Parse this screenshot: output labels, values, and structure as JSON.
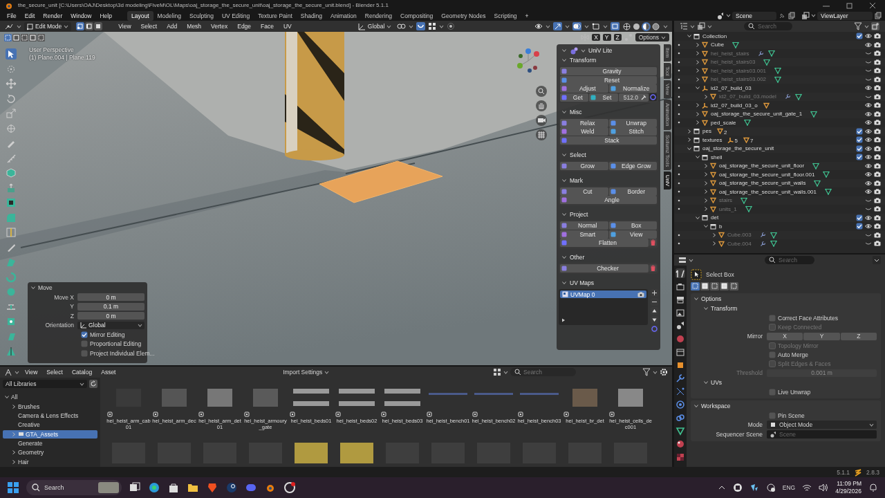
{
  "window": {
    "title": "the_secure_unit [C:\\Users\\OAJ\\Desktop\\3d modeling\\FiveM\\OL\\Maps\\oaj_storage_the_secure_unit\\oaj_storage_the_secure_unit.blend] - Blender 5.1.1"
  },
  "menu": [
    "File",
    "Edit",
    "Render",
    "Window",
    "Help"
  ],
  "workspaces": [
    {
      "label": "Layout",
      "selected": true
    },
    {
      "label": "Modeling",
      "selected": false
    },
    {
      "label": "Sculpting",
      "selected": false
    },
    {
      "label": "UV Editing",
      "selected": false
    },
    {
      "label": "Texture Paint",
      "selected": false
    },
    {
      "label": "Shading",
      "selected": false
    },
    {
      "label": "Animation",
      "selected": false
    },
    {
      "label": "Rendering",
      "selected": false
    },
    {
      "label": "Compositing",
      "selected": false
    },
    {
      "label": "Geometry Nodes",
      "selected": false
    },
    {
      "label": "Scripting",
      "selected": false
    }
  ],
  "add_workspace": "+",
  "scene": {
    "scene": "Scene",
    "view_layer": "ViewLayer"
  },
  "viewport": {
    "mode": "Edit Mode",
    "select_modes": [
      {
        "selected": true
      },
      {
        "selected": false
      },
      {
        "selected": false
      }
    ],
    "menus": [
      "View",
      "Select",
      "Add",
      "Mesh",
      "Vertex",
      "Edge",
      "Face",
      "UV"
    ],
    "orientation": "Global",
    "shading_modes": [
      {
        "selected": false
      },
      {
        "selected": false
      },
      {
        "selected": true
      },
      {
        "selected": false
      }
    ],
    "tool_modes": [
      {
        "selected": true
      },
      {
        "selected": false
      },
      {
        "selected": false
      },
      {
        "selected": false
      },
      {
        "selected": false
      }
    ],
    "mirror_axes": [
      "X",
      "Y",
      "Z"
    ],
    "options": "Options",
    "view_name": "User Perspective",
    "view_info": "(1) Plane.004 | Plane.119"
  },
  "operator_panel": {
    "title": "Move",
    "expanded": true,
    "fields": [
      {
        "label": "Move X",
        "value": "0 m"
      },
      {
        "label": "Y",
        "value": "0.1 m"
      },
      {
        "label": "Z",
        "value": "0 m"
      }
    ],
    "orientation": {
      "label": "Orientation",
      "value": "Global"
    },
    "options": [
      {
        "label": "Mirror Editing",
        "checked": true
      },
      {
        "label": "Proportional Editing",
        "checked": false
      },
      {
        "label": "Project Individual Elem...",
        "checked": false
      }
    ]
  },
  "uv_panel": {
    "title": "UniV Lite",
    "sections": [
      {
        "title": "Transform",
        "expanded": true,
        "rows": [
          {
            "buttons": [
              "Gravity"
            ]
          },
          {
            "buttons": [
              "Reset"
            ]
          },
          {
            "buttons": [
              "Adjust",
              "Normalize"
            ]
          },
          {
            "buttons": [
              "Get",
              "Set"
            ],
            "value": "512.0"
          }
        ]
      },
      {
        "title": "Misc",
        "expanded": true,
        "rows": [
          {
            "buttons": [
              "Relax",
              "Unwrap"
            ]
          },
          {
            "buttons": [
              "Weld",
              "Stitch"
            ]
          },
          {
            "buttons": [
              "Stack"
            ]
          }
        ]
      },
      {
        "title": "Select",
        "expanded": true,
        "rows": [
          {
            "buttons": [
              "Grow",
              "Edge Grow"
            ]
          }
        ]
      },
      {
        "title": "Mark",
        "expanded": true,
        "rows": [
          {
            "buttons": [
              "Cut",
              "Border"
            ]
          },
          {
            "buttons": [
              "Angle"
            ]
          }
        ]
      },
      {
        "title": "Project",
        "expanded": true,
        "rows": [
          {
            "buttons": [
              "Normal",
              "Box"
            ]
          },
          {
            "buttons": [
              "Smart",
              "View"
            ]
          },
          {
            "buttons": [
              "Flatten"
            ],
            "delete": true
          }
        ]
      },
      {
        "title": "Other",
        "expanded": true,
        "rows": [
          {
            "buttons": [
              "Checker"
            ],
            "delete": true
          }
        ]
      }
    ],
    "uv_maps": {
      "title": "UV Maps",
      "expanded": true,
      "items": [
        {
          "label": "UVMap 0",
          "selected": true
        }
      ]
    }
  },
  "side_tabs": [
    {
      "label": "Item",
      "selected": false
    },
    {
      "label": "Tool",
      "selected": false
    },
    {
      "label": "View",
      "selected": false
    },
    {
      "label": "Animation",
      "selected": false
    },
    {
      "label": "Sollumz Tools",
      "selected": false
    },
    {
      "label": "UniV",
      "selected": true
    }
  ],
  "outliner": {
    "search_placeholder": "Search",
    "items": [
      {
        "label": "Collection",
        "kind": "collection",
        "expanded": true,
        "checked": true,
        "visible": true,
        "children": [
          {
            "label": "Cube",
            "kind": "mesh",
            "expanded": false,
            "visible": true,
            "modifier": false
          },
          {
            "label": "hei_heist_stairs",
            "kind": "mesh",
            "expanded": false,
            "visible": false,
            "modifier": true
          },
          {
            "label": "hei_heist_stairs03",
            "kind": "mesh",
            "expanded": false,
            "visible": false,
            "modifier": false
          },
          {
            "label": "hei_heist_stairs03.001",
            "kind": "mesh",
            "expanded": false,
            "visible": false,
            "modifier": false
          },
          {
            "label": "hei_heist_stairs03.002",
            "kind": "mesh",
            "expanded": false,
            "visible": false,
            "modifier": false
          },
          {
            "label": "id2_07_build_03",
            "kind": "empty",
            "expanded": true,
            "visible": true,
            "children": [
              {
                "label": "id2_07_build_03.model",
                "kind": "mesh",
                "expanded": false,
                "visible": false,
                "modifier": true
              }
            ]
          },
          {
            "label": "id2_07_build_03_o",
            "kind": "empty",
            "expanded": false,
            "visible": true,
            "contents": [
              {
                "kind": "mesh"
              }
            ]
          },
          {
            "label": "oaj_storage_the_secure_unit_gate_1",
            "kind": "mesh",
            "expanded": false,
            "visible": true,
            "modifier": false
          },
          {
            "label": "ped_scale",
            "kind": "mesh",
            "expanded": false,
            "visible": true,
            "modifier": false
          }
        ]
      },
      {
        "label": "pes",
        "kind": "collection",
        "expanded": false,
        "checked": true,
        "visible": true,
        "contents": [
          {
            "kind": "mesh",
            "count": "2"
          }
        ]
      },
      {
        "label": "textures",
        "kind": "collection",
        "expanded": false,
        "checked": true,
        "visible": true,
        "contents": [
          {
            "kind": "empty",
            "count": "5"
          },
          {
            "kind": "mesh",
            "count": "7"
          }
        ]
      },
      {
        "label": "oaj_storage_the_secure_unit",
        "kind": "collection",
        "expanded": true,
        "checked": true,
        "visible": true,
        "children": [
          {
            "label": "shell",
            "kind": "collection",
            "expanded": true,
            "checked": true,
            "visible": true,
            "children": [
              {
                "label": "oaj_storage_the_secure_unit_floor",
                "kind": "mesh",
                "expanded": false,
                "visible": true,
                "modifier": false
              },
              {
                "label": "oaj_storage_the_secure_unit_floor.001",
                "kind": "mesh",
                "expanded": false,
                "visible": true,
                "modifier": false
              },
              {
                "label": "oaj_storage_the_secure_unit_walls",
                "kind": "mesh",
                "expanded": false,
                "visible": true,
                "modifier": false
              },
              {
                "label": "oaj_storage_the_secure_unit_walls.001",
                "kind": "mesh",
                "expanded": false,
                "visible": true,
                "modifier": false
              },
              {
                "label": "stairs",
                "kind": "mesh",
                "expanded": false,
                "visible": false,
                "modifier": false
              },
              {
                "label": "units_1",
                "kind": "mesh",
                "expanded": false,
                "visible": false,
                "modifier": false
              }
            ]
          },
          {
            "label": "det",
            "kind": "collection",
            "expanded": true,
            "checked": true,
            "visible": true,
            "children": [
              {
                "label": "b",
                "kind": "collection",
                "expanded": true,
                "checked": true,
                "visible": true,
                "children": [
                  {
                    "label": "Cube.003",
                    "kind": "mesh",
                    "expanded": false,
                    "visible": false,
                    "modifier": true
                  },
                  {
                    "label": "Cube.004",
                    "kind": "mesh",
                    "expanded": false,
                    "visible": false,
                    "modifier": true
                  }
                ]
              }
            ]
          }
        ]
      }
    ]
  },
  "properties": {
    "search_placeholder": "Search",
    "tool": "Select Box",
    "tool_modes": [
      {
        "selected": true
      },
      {
        "selected": false
      },
      {
        "selected": false
      },
      {
        "selected": false
      },
      {
        "selected": false
      }
    ],
    "options": {
      "title": "Options",
      "expanded": true,
      "transform": {
        "title": "Transform",
        "expanded": true,
        "checks_top": [
          {
            "label": "Correct Face Attributes",
            "checked": false,
            "disabled": false
          },
          {
            "label": "Keep Connected",
            "checked": false,
            "disabled": true
          }
        ],
        "mirror": {
          "label": "Mirror",
          "axes": [
            {
              "label": "X",
              "on": false
            },
            {
              "label": "Y",
              "on": false
            },
            {
              "label": "Z",
              "on": false
            }
          ]
        },
        "checks_bottom": [
          {
            "label": "Topology Mirror",
            "checked": false,
            "disabled": true
          },
          {
            "label": "Auto Merge",
            "checked": false,
            "disabled": false
          },
          {
            "label": "Split Edges & Faces",
            "checked": false,
            "disabled": true
          }
        ],
        "threshold": {
          "label": "Threshold",
          "value": "0.001 m",
          "disabled": true
        }
      },
      "uvs": {
        "title": "UVs",
        "expanded": true,
        "checks": [
          {
            "label": "Live Unwrap",
            "checked": false,
            "disabled": false
          }
        ]
      }
    },
    "workspace": {
      "title": "Workspace",
      "expanded": true,
      "pin": {
        "label": "Pin Scene",
        "checked": false,
        "disabled": false
      },
      "mode": {
        "label": "Mode",
        "value": "Object Mode"
      },
      "sequencer": {
        "label": "Sequencer Scene",
        "placeholder": "Scene"
      }
    }
  },
  "asset_browser": {
    "menus": [
      "View",
      "Select",
      "Catalog",
      "Asset"
    ],
    "import_settings": "Import Settings",
    "search_placeholder": "Search",
    "library": "All Libraries",
    "catalogs": [
      {
        "label": "All",
        "expanded": true,
        "selected": false,
        "children": [
          {
            "label": "Brushes",
            "expanded": false,
            "selected": false
          },
          {
            "label": "Camera & Lens Effects",
            "selected": false
          },
          {
            "label": "Creative",
            "selected": false
          },
          {
            "label": "GTA_Assets",
            "expanded": false,
            "selected": true
          },
          {
            "label": "Generate",
            "selected": false
          },
          {
            "label": "Geometry",
            "expanded": false,
            "selected": false
          },
          {
            "label": "Hair",
            "expanded": false,
            "selected": false
          }
        ]
      }
    ],
    "assets": [
      {
        "name": "hei_heist_arm_cab01"
      },
      {
        "name": "hei_heist_arm_dec"
      },
      {
        "name": "hei_heist_arm_det01"
      },
      {
        "name": "hei_heist_armoury_gate"
      },
      {
        "name": "hei_heist_beds01"
      },
      {
        "name": "hei_heist_beds02"
      },
      {
        "name": "hei_heist_beds03"
      },
      {
        "name": "hei_heist_bench01"
      },
      {
        "name": "hei_heist_bench02"
      },
      {
        "name": "hei_heist_bench03"
      },
      {
        "name": "hei_heist_br_det"
      },
      {
        "name": "hei_heist_cells_dec001"
      }
    ]
  },
  "status_bar": {
    "version": "5.1.1",
    "addon_version": "2.8.3"
  },
  "taskbar": {
    "search_placeholder": "Search",
    "language": "ENG",
    "time": "11:09 PM",
    "date": "4/29/2026"
  }
}
